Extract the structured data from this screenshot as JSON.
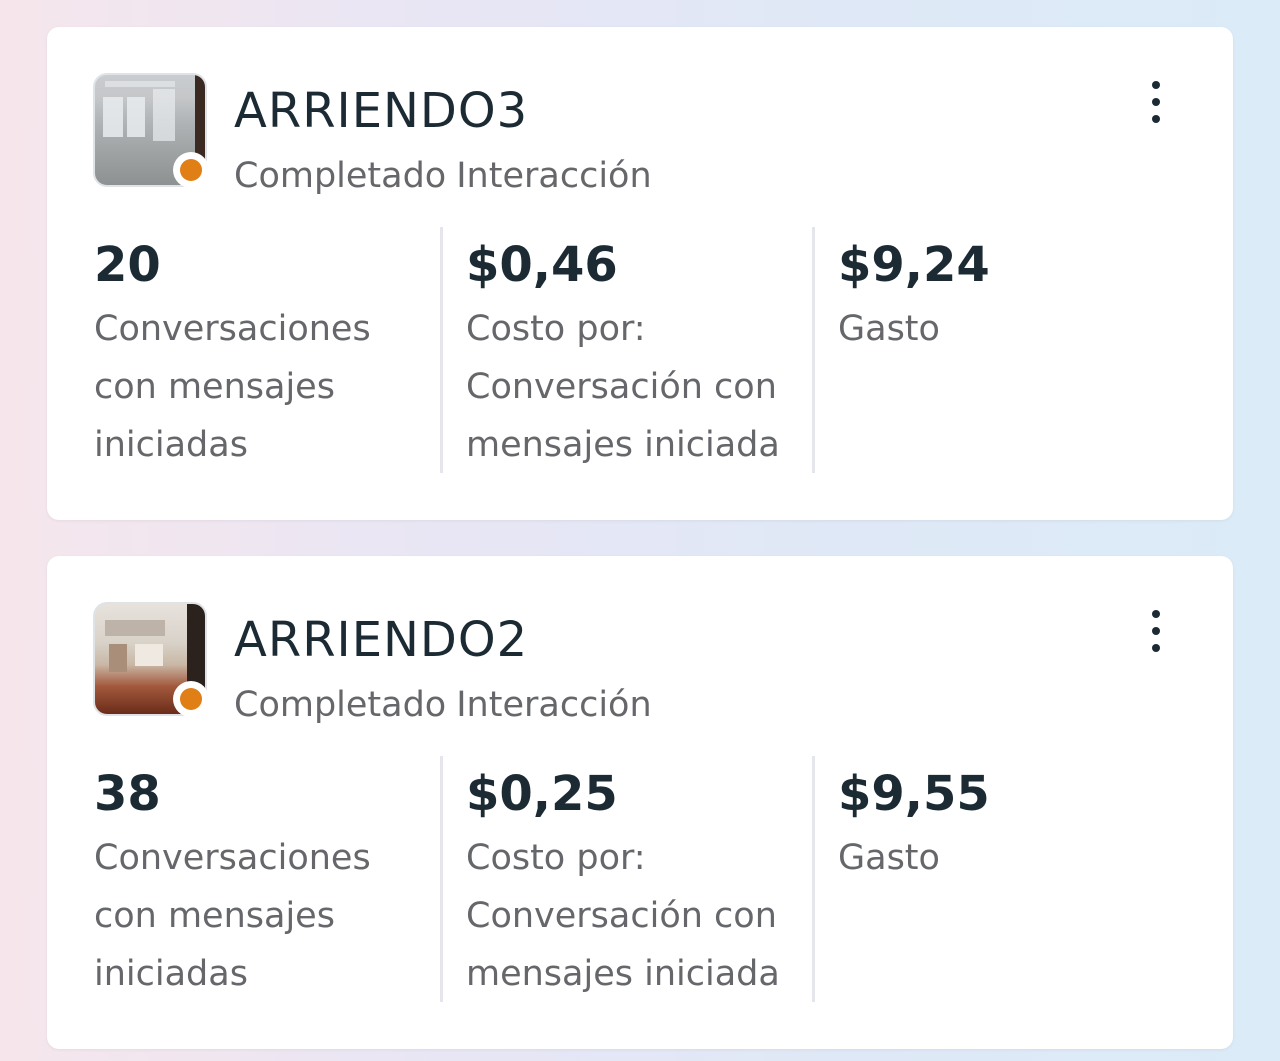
{
  "campaigns": [
    {
      "name": "ARRIENDO3",
      "status": "Completado",
      "objective": "Interacción",
      "status_color": "#e07f16",
      "thumbnail": "apartment-interior-photo",
      "metrics": [
        {
          "value": "20",
          "label": "Conversaciones con mensajes iniciadas"
        },
        {
          "value": "$0,46",
          "label": "Costo por: Conversación con mensajes iniciada"
        },
        {
          "value": "$9,24",
          "label": "Gasto"
        }
      ]
    },
    {
      "name": "ARRIENDO2",
      "status": "Completado",
      "objective": "Interacción",
      "status_color": "#e07f16",
      "thumbnail": "kitchen-interior-photo",
      "metrics": [
        {
          "value": "38",
          "label": "Conversaciones con mensajes iniciadas"
        },
        {
          "value": "$0,25",
          "label": "Costo por: Conversación con mensajes iniciada"
        },
        {
          "value": "$9,55",
          "label": "Gasto"
        }
      ]
    }
  ]
}
